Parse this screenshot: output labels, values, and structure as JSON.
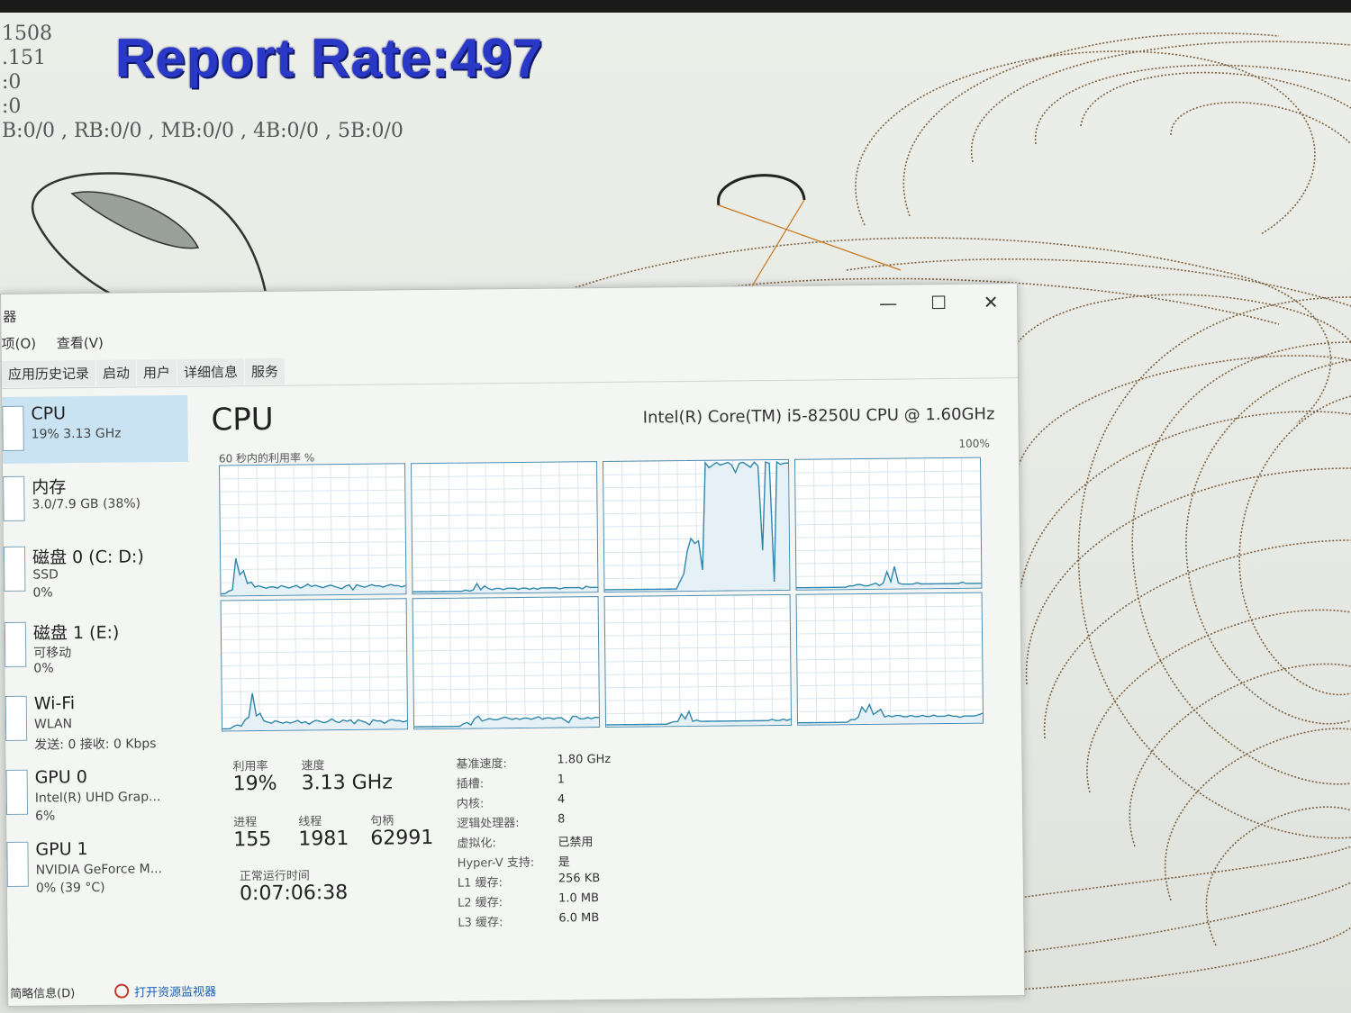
{
  "tracker": {
    "lines": [
      "1508",
      ".151",
      ":0",
      ":0",
      "B:0/0 , RB:0/0 , MB:0/0  , 4B:0/0  , 5B:0/0"
    ],
    "report_rate": "Report Rate:497"
  },
  "task_manager": {
    "title": "器",
    "menu": [
      "项(O)",
      "查看(V)"
    ],
    "tabs": [
      "应用历史记录",
      "启动",
      "用户",
      "详细信息",
      "服务"
    ],
    "window_buttons": {
      "minimize": "—",
      "maximize": "☐",
      "close": "✕"
    },
    "sidebar": [
      {
        "name": "CPU",
        "sub": "19% 3.13 GHz",
        "sub2": ""
      },
      {
        "name": "内存",
        "sub": "3.0/7.9 GB (38%)",
        "sub2": ""
      },
      {
        "name": "磁盘 0 (C: D:)",
        "sub": "SSD",
        "sub2": "0%"
      },
      {
        "name": "磁盘 1 (E:)",
        "sub": "可移动",
        "sub2": "0%"
      },
      {
        "name": "Wi-Fi",
        "sub": "WLAN",
        "sub2": "发送: 0 接收: 0 Kbps"
      },
      {
        "name": "GPU 0",
        "sub": "Intel(R) UHD Grap...",
        "sub2": "6%"
      },
      {
        "name": "GPU 1",
        "sub": "NVIDIA GeForce M...",
        "sub2": "0% (39 °C)"
      }
    ],
    "main": {
      "heading": "CPU",
      "model": "Intel(R) Core(TM) i5-8250U CPU @ 1.60GHz",
      "util_label": "60 秒内的利用率 %",
      "util_max": "100%",
      "core_graphs": [
        [
          0,
          0,
          2,
          3,
          28,
          15,
          18,
          8,
          9,
          5,
          6,
          5,
          4,
          5,
          5,
          4,
          6,
          5,
          4,
          5,
          6,
          4,
          5,
          7,
          5,
          6,
          5,
          4,
          5,
          6,
          5,
          4,
          3,
          5,
          6,
          2,
          6,
          5,
          4,
          5,
          6,
          5,
          5,
          4,
          5,
          6,
          5,
          5,
          4,
          5
        ],
        [
          0,
          0,
          0,
          0,
          0,
          0,
          0,
          0,
          0,
          0,
          0,
          0,
          0,
          0,
          1,
          0,
          1,
          6,
          1,
          4,
          2,
          1,
          2,
          2,
          1,
          2,
          2,
          2,
          1,
          2,
          2,
          1,
          2,
          1,
          2,
          2,
          2,
          2,
          2,
          1,
          2,
          2,
          2,
          2,
          2,
          1,
          3,
          2,
          2,
          2
        ],
        [
          0,
          0,
          0,
          0,
          0,
          0,
          0,
          0,
          0,
          0,
          0,
          0,
          0,
          0,
          0,
          0,
          0,
          0,
          0,
          0,
          6,
          12,
          30,
          40,
          36,
          38,
          15,
          100,
          96,
          98,
          100,
          98,
          99,
          100,
          98,
          92,
          99,
          100,
          98,
          96,
          100,
          97,
          30,
          100,
          99,
          5,
          100,
          98,
          99,
          99
        ],
        [
          0,
          0,
          0,
          0,
          0,
          0,
          0,
          0,
          0,
          0,
          0,
          0,
          0,
          0,
          1,
          1,
          2,
          2,
          1,
          1,
          2,
          3,
          1,
          3,
          12,
          4,
          16,
          3,
          2,
          2,
          2,
          2,
          3,
          2,
          2,
          2,
          2,
          2,
          2,
          2,
          2,
          2,
          2,
          2,
          3,
          2,
          2,
          2,
          2,
          2
        ],
        [
          0,
          0,
          0,
          2,
          3,
          2,
          7,
          9,
          28,
          10,
          12,
          6,
          5,
          4,
          6,
          5,
          4,
          5,
          4,
          5,
          6,
          4,
          5,
          3,
          5,
          6,
          5,
          4,
          5,
          7,
          5,
          4,
          6,
          5,
          6,
          3,
          6,
          5,
          4,
          2,
          6,
          5,
          5,
          3,
          5,
          6,
          5,
          5,
          4,
          5
        ],
        [
          0,
          0,
          0,
          0,
          0,
          0,
          0,
          0,
          0,
          0,
          0,
          0,
          0,
          2,
          3,
          1,
          6,
          8,
          4,
          5,
          6,
          5,
          5,
          6,
          7,
          6,
          5,
          6,
          5,
          6,
          6,
          5,
          6,
          7,
          5,
          6,
          6,
          5,
          6,
          6,
          4,
          2,
          7,
          7,
          5,
          5,
          6,
          5,
          6,
          6
        ],
        [
          0,
          0,
          0,
          0,
          0,
          0,
          0,
          0,
          0,
          0,
          0,
          0,
          0,
          0,
          0,
          0,
          0,
          1,
          2,
          2,
          8,
          4,
          10,
          2,
          3,
          2,
          2,
          2,
          2,
          2,
          2,
          2,
          2,
          2,
          2,
          2,
          2,
          2,
          2,
          2,
          2,
          2,
          2,
          2,
          3,
          2,
          2,
          3,
          2,
          3
        ],
        [
          0,
          0,
          0,
          0,
          0,
          0,
          0,
          0,
          0,
          0,
          0,
          0,
          0,
          0,
          2,
          2,
          4,
          12,
          8,
          14,
          6,
          8,
          10,
          4,
          5,
          4,
          5,
          5,
          4,
          4,
          5,
          4,
          4,
          5,
          4,
          4,
          5,
          4,
          4,
          4,
          5,
          4,
          4,
          3,
          4,
          4,
          4,
          4,
          5,
          6
        ]
      ],
      "stats": {
        "util_label": "利用率",
        "util": "19%",
        "speed_label": "速度",
        "speed": "3.13 GHz",
        "proc_label": "进程",
        "proc": "155",
        "threads_label": "线程",
        "threads": "1981",
        "handles_label": "句柄",
        "handles": "62991",
        "uptime_label": "正常运行时间",
        "uptime": "0:07:06:38"
      },
      "details": [
        {
          "key": "基准速度:",
          "val": "1.80 GHz"
        },
        {
          "key": "插槽:",
          "val": "1"
        },
        {
          "key": "内核:",
          "val": "4"
        },
        {
          "key": "逻辑处理器:",
          "val": "8"
        },
        {
          "key": "虚拟化:",
          "val": "已禁用"
        },
        {
          "key": "Hyper-V 支持:",
          "val": "是"
        },
        {
          "key": "L1 缓存:",
          "val": "256 KB"
        },
        {
          "key": "L2 缓存:",
          "val": "1.0 MB"
        },
        {
          "key": "L3 缓存:",
          "val": "6.0 MB"
        }
      ]
    },
    "footer": {
      "fewer": "简略信息(D)",
      "monitor": "打开资源监视器"
    }
  },
  "colors": {
    "accent": "#2a38c8",
    "graph_line": "#2e86ab",
    "selection": "#c9e3f2",
    "trace": "#6b4a24"
  }
}
